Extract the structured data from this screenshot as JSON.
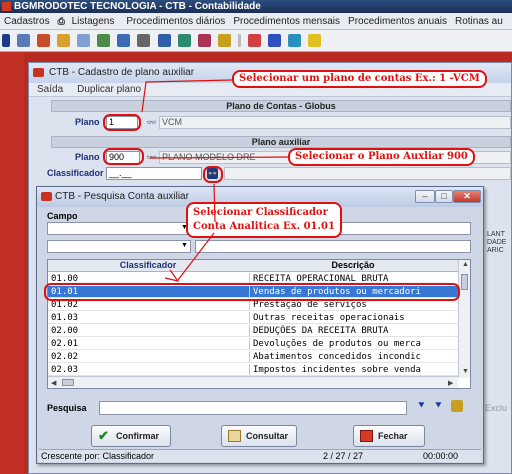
{
  "app": {
    "title": "BGMRODOTEC TECNOLOGIA - CTB - Contabilidade",
    "menu": [
      "Cadastros",
      "Listagens",
      "Procedimentos diários",
      "Procedimentos mensais",
      "Procedimentos anuais",
      "Rotinas au"
    ]
  },
  "plano_window": {
    "title": "CTB - Cadastro de plano auxiliar",
    "menu": [
      "Saída",
      "Duplicar plano"
    ],
    "section_plano": "Plano de Contas - Globus",
    "plano_label": "Plano",
    "plano_value": "1",
    "plano_desc": "VCM",
    "section_aux": "Plano auxiliar",
    "aux_plano_label": "Plano",
    "aux_plano_value": "900",
    "aux_plano_desc": "PLANO MODELO DRE",
    "classificador_label": "Classificador",
    "classificador_value": "__.__",
    "side_text": [
      "LANT",
      "DADE",
      "ARIC"
    ],
    "exclu_label": "Exclu"
  },
  "annotations": {
    "note1": "Selecionar um plano de contas Ex.: 1 -VCM",
    "note2": "Selecionar o Plano Auxliar 900",
    "note3a": "Selecionar Classificador",
    "note3b": "Conta Analitica Ex. 01.01"
  },
  "dialog": {
    "title": "CTB - Pesquisa Conta auxiliar",
    "campo_label": "Campo",
    "columns": [
      "Classificador",
      "Descrição"
    ],
    "rows": [
      {
        "cls": "01.00",
        "desc": "RECEITA OPERACIONAL BRUTA"
      },
      {
        "cls": "01.01",
        "desc": "Vendas de produtos ou mercadori"
      },
      {
        "cls": "01.02",
        "desc": "Prestação de serviços"
      },
      {
        "cls": "01.03",
        "desc": "Outras receitas operacionais"
      },
      {
        "cls": "02.00",
        "desc": "DEDUÇÕES DA RECEITA BRUTA"
      },
      {
        "cls": "02.01",
        "desc": "Devoluções de produtos ou merca"
      },
      {
        "cls": "02.02",
        "desc": "Abatimentos concedidos incondic"
      },
      {
        "cls": "02.03",
        "desc": "Impostos incidentes sobre venda"
      }
    ],
    "selected_index": 1,
    "pesquisa_label": "Pesquisa",
    "buttons": {
      "confirmar": "Confirmar",
      "consultar": "Consultar",
      "fechar": "Fechar"
    },
    "status": {
      "order": "Crescente por: Classificador",
      "count": "2 / 27 / 27",
      "time": "00:00:00"
    }
  }
}
